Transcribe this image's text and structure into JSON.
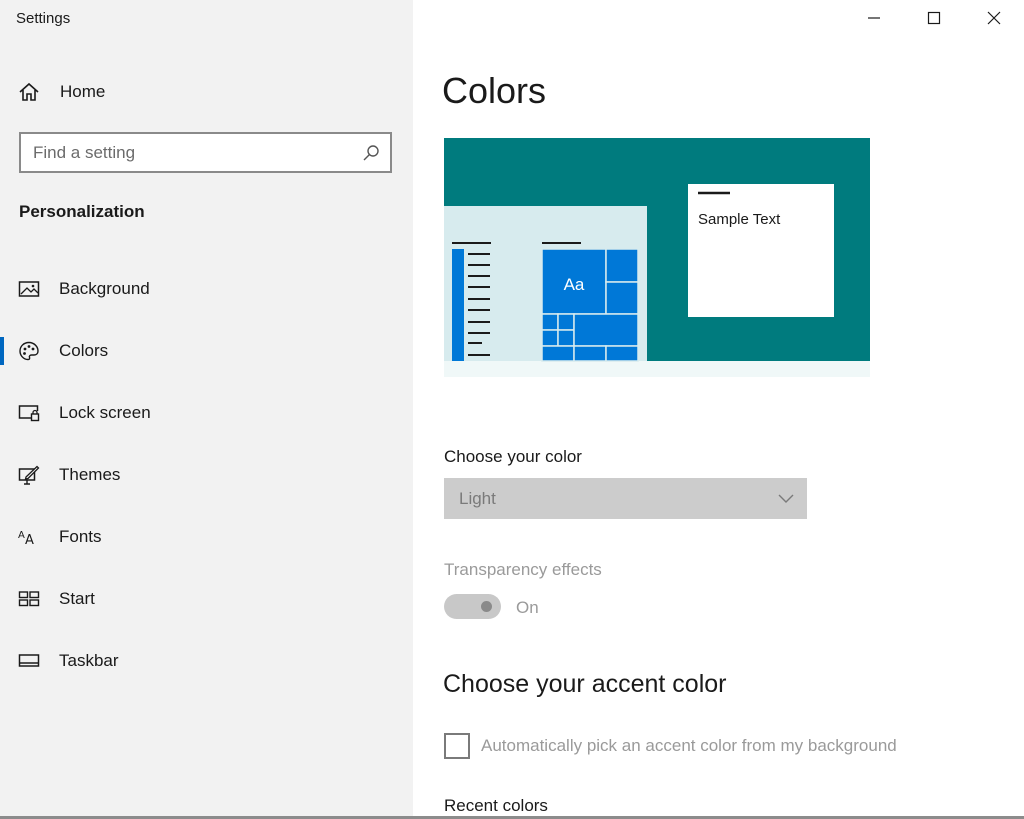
{
  "window": {
    "title": "Settings",
    "controls": [
      "minimize-icon",
      "maximize-icon",
      "close-icon"
    ]
  },
  "sidebar": {
    "home_label": "Home",
    "search": {
      "placeholder": "Find a setting"
    },
    "section_title": "Personalization",
    "items": [
      {
        "label": "Background",
        "icon": "picture-icon",
        "selected": false
      },
      {
        "label": "Colors",
        "icon": "palette-icon",
        "selected": true
      },
      {
        "label": "Lock screen",
        "icon": "lock-screen-icon",
        "selected": false
      },
      {
        "label": "Themes",
        "icon": "themes-icon",
        "selected": false
      },
      {
        "label": "Fonts",
        "icon": "fonts-icon",
        "selected": false
      },
      {
        "label": "Start",
        "icon": "start-icon",
        "selected": false
      },
      {
        "label": "Taskbar",
        "icon": "taskbar-icon",
        "selected": false
      }
    ]
  },
  "main": {
    "title": "Colors",
    "preview": {
      "sample_text": "Sample Text",
      "tile_text": "Aa",
      "colors": {
        "background": "#007b7e",
        "tiles": "#0078d7",
        "panel": "#d7ebee",
        "strip": "#f0f8f8"
      }
    },
    "choose_color": {
      "label": "Choose your color",
      "value": "Light"
    },
    "transparency": {
      "label": "Transparency effects",
      "state": "On"
    },
    "accent": {
      "heading": "Choose your accent color",
      "auto_pick_label": "Automatically pick an accent color from my background",
      "recent_label": "Recent colors"
    }
  },
  "colors": {
    "sidebar_bg": "#f2f2f2",
    "selection_accent": "#0067c0",
    "disabled_text": "#9a9a9a"
  }
}
